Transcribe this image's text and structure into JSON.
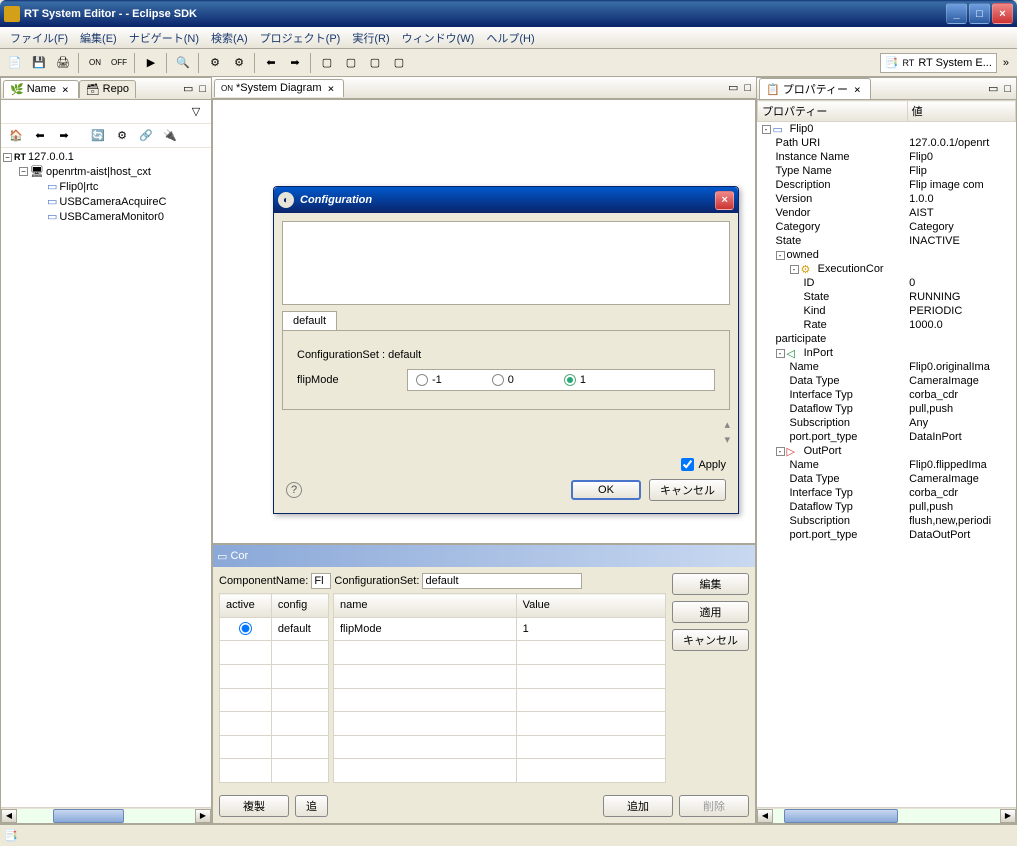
{
  "window": {
    "title": "RT System Editor -  - Eclipse SDK"
  },
  "menus": [
    "ファイル(F)",
    "編集(E)",
    "ナビゲート(N)",
    "検索(A)",
    "プロジェクト(P)",
    "実行(R)",
    "ウィンドウ(W)",
    "ヘルプ(H)"
  ],
  "top_tab": "RT System E...",
  "left": {
    "tabs": [
      "Name",
      "Repo"
    ],
    "tree": {
      "root": "127.0.0.1",
      "ctx": "openrtm-aist|host_cxt",
      "items": [
        "Flip0|rtc",
        "USBCameraAcquireC",
        "USBCameraMonitor0"
      ]
    }
  },
  "center_tab": "*System Diagram",
  "dialog": {
    "title": "Configuration",
    "tab": "default",
    "cfgset_label": "ConfigurationSet :",
    "cfgset_value": "default",
    "param": "flipMode",
    "options": [
      "-1",
      "0",
      "1"
    ],
    "selected": "1",
    "apply_cb": "Apply",
    "ok": "OK",
    "cancel": "キャンセル"
  },
  "configview": {
    "tab": "Cor",
    "componentname_label": "ComponentName:",
    "componentname_value": "Fl",
    "cfgset_label": "ConfigurationSet:",
    "cfgset_value": "default",
    "th_active": "active",
    "th_config": "config",
    "row_config": "default",
    "th_name": "name",
    "th_value": "Value",
    "row_name": "flipMode",
    "row_value": "1",
    "btn_edit": "編集",
    "btn_apply": "適用",
    "btn_cancel": "キャンセル",
    "btn_dup": "複製",
    "btn_add2": "追",
    "btn_add": "追加",
    "btn_del": "削除"
  },
  "props": {
    "title": "プロパティー",
    "col1": "プロパティー",
    "col2": "値",
    "rows": [
      {
        "indent": 0,
        "exp": "-",
        "icon": "comp",
        "name": "Flip0",
        "value": ""
      },
      {
        "indent": 1,
        "name": "Path URI",
        "value": "127.0.0.1/openrt"
      },
      {
        "indent": 1,
        "name": "Instance Name",
        "value": "Flip0"
      },
      {
        "indent": 1,
        "name": "Type Name",
        "value": "Flip"
      },
      {
        "indent": 1,
        "name": "Description",
        "value": "Flip image com"
      },
      {
        "indent": 1,
        "name": "Version",
        "value": "1.0.0"
      },
      {
        "indent": 1,
        "name": "Vendor",
        "value": "AIST"
      },
      {
        "indent": 1,
        "name": "Category",
        "value": "Category"
      },
      {
        "indent": 1,
        "name": "State",
        "value": "INACTIVE"
      },
      {
        "indent": 1,
        "exp": "-",
        "name": "owned",
        "value": ""
      },
      {
        "indent": 2,
        "exp": "-",
        "icon": "exec",
        "name": "ExecutionCor",
        "value": ""
      },
      {
        "indent": 3,
        "name": "ID",
        "value": "0"
      },
      {
        "indent": 3,
        "name": "State",
        "value": "RUNNING"
      },
      {
        "indent": 3,
        "name": "Kind",
        "value": "PERIODIC"
      },
      {
        "indent": 3,
        "name": "Rate",
        "value": "1000.0"
      },
      {
        "indent": 1,
        "name": "participate",
        "value": ""
      },
      {
        "indent": 1,
        "exp": "-",
        "icon": "inport",
        "name": "InPort",
        "value": ""
      },
      {
        "indent": 2,
        "name": "Name",
        "value": "Flip0.originalIma"
      },
      {
        "indent": 2,
        "name": "Data Type",
        "value": "CameraImage"
      },
      {
        "indent": 2,
        "name": "Interface Typ",
        "value": "corba_cdr"
      },
      {
        "indent": 2,
        "name": "Dataflow Typ",
        "value": "pull,push"
      },
      {
        "indent": 2,
        "name": "Subscription",
        "value": "Any"
      },
      {
        "indent": 2,
        "name": "port.port_type",
        "value": "DataInPort"
      },
      {
        "indent": 1,
        "exp": "-",
        "icon": "outport",
        "name": "OutPort",
        "value": ""
      },
      {
        "indent": 2,
        "name": "Name",
        "value": "Flip0.flippedIma"
      },
      {
        "indent": 2,
        "name": "Data Type",
        "value": "CameraImage"
      },
      {
        "indent": 2,
        "name": "Interface Typ",
        "value": "corba_cdr"
      },
      {
        "indent": 2,
        "name": "Dataflow Typ",
        "value": "pull,push"
      },
      {
        "indent": 2,
        "name": "Subscription",
        "value": "flush,new,periodi"
      },
      {
        "indent": 2,
        "name": "port.port_type",
        "value": "DataOutPort"
      }
    ]
  }
}
